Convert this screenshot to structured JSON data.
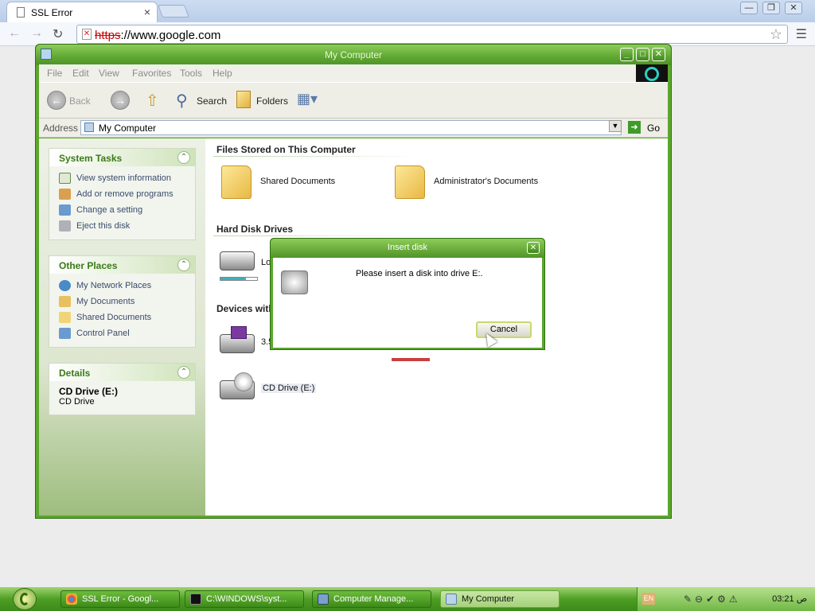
{
  "browser": {
    "tab_title": "SSL Error",
    "tab_close": "×",
    "omnibox": {
      "scheme": "https",
      "rest": "://www.google.com"
    },
    "window_buttons": [
      "—",
      "❐",
      "✕"
    ]
  },
  "explorer": {
    "title": "My Computer",
    "menu": [
      "File",
      "Edit",
      "View",
      "Favorites",
      "Tools",
      "Help"
    ],
    "toolbar": {
      "back": "Back",
      "search": "Search",
      "folders": "Folders"
    },
    "address": {
      "label": "Address",
      "value": "My Computer",
      "go": "Go"
    },
    "system_tasks": {
      "title": "System Tasks",
      "items": [
        "View system information",
        "Add or remove programs",
        "Change a setting",
        "Eject this disk"
      ]
    },
    "other_places": {
      "title": "Other Places",
      "items": [
        "My Network Places",
        "My Documents",
        "Shared Documents",
        "Control Panel"
      ]
    },
    "details": {
      "title": "Details",
      "name": "CD Drive (E:)",
      "type": "CD Drive"
    },
    "sections": {
      "files": "Files Stored on This Computer",
      "hdd": "Hard Disk Drives",
      "devices": "Devices with"
    },
    "files": [
      "Shared Documents",
      "Administrator's Documents"
    ],
    "hdd_partial": "Lo",
    "device_partial": "3.5",
    "cd_drive": "CD Drive (E:)"
  },
  "dialog": {
    "title": "Insert disk",
    "message": "Please insert a disk into drive E:.",
    "cancel": "Cancel",
    "close": "✕"
  },
  "taskbar": {
    "tasks": [
      "SSL Error - Googl...",
      "C:\\WINDOWS\\syst...",
      "Computer Manage...",
      "My Computer"
    ],
    "lang": "EN",
    "clock": "03:21 ص"
  }
}
